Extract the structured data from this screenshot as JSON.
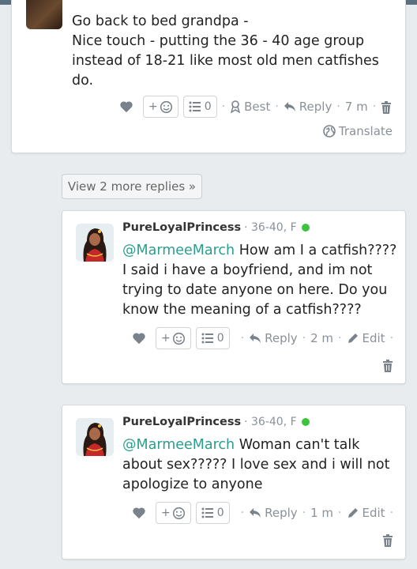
{
  "comment_top": {
    "body": "Go back to bed grandpa -\nNice touch - putting the 36 - 40 age group instead of 18-21 like most old men catfishes do.",
    "react_label": "+",
    "list_count": "0",
    "best_label": "Best",
    "reply_label": "Reply",
    "time": "7 m",
    "translate_label": "Translate"
  },
  "view_more": "View 2 more replies »",
  "replies": [
    {
      "username": "PureLoyalPrincess",
      "demo": "· 36-40, F",
      "mention": "@MarmeeMarch",
      "text": " How am I a catfish???? I said i have a boyfriend, and im not trying to date anyone on here. Do you know the meaning of a catfish????",
      "react_label": "+",
      "list_count": "0",
      "reply_label": "Reply",
      "time": "2 m",
      "edit_label": "Edit"
    },
    {
      "username": "PureLoyalPrincess",
      "demo": "· 36-40, F",
      "mention": "@MarmeeMarch",
      "text": " Woman can't talk about sex????? I love sex and i will not apologize to anyone",
      "react_label": "+",
      "list_count": "0",
      "reply_label": "Reply",
      "time": "1 m",
      "edit_label": "Edit"
    }
  ],
  "colors": {
    "accent": "#2a9d8f",
    "online": "#3bc43b",
    "muted": "#8a9199"
  }
}
